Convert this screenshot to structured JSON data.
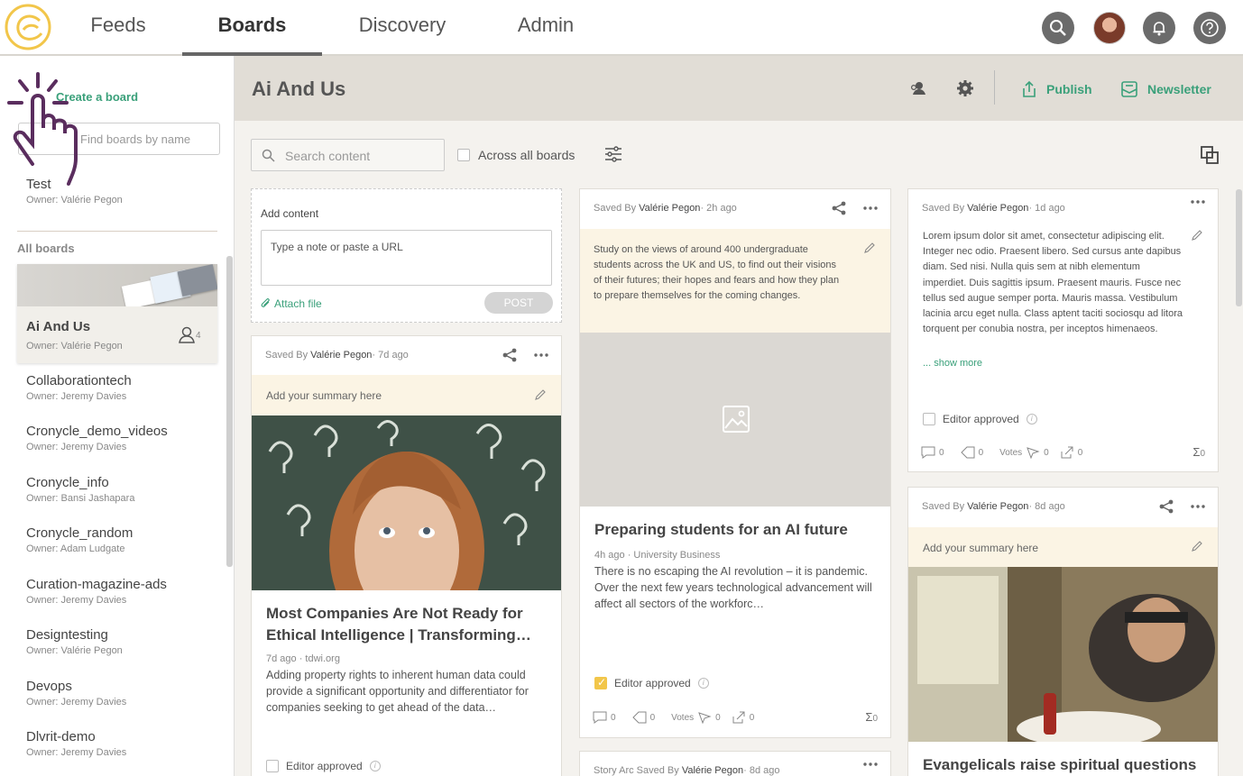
{
  "nav": {
    "tabs": [
      "Feeds",
      "Boards",
      "Discovery",
      "Admin"
    ],
    "active_tab": "Boards"
  },
  "sidebar": {
    "create_label": "Create a board",
    "search_placeholder": "Find boards by name",
    "test_board": {
      "name": "Test",
      "owner": "Owner: Valérie Pegon"
    },
    "all_boards_label": "All boards",
    "active_board": {
      "name": "Ai And Us",
      "owner": "Owner: Valérie Pegon",
      "members": "4"
    },
    "boards": [
      {
        "name": "Collaborationtech",
        "owner": "Owner: Jeremy Davies"
      },
      {
        "name": "Cronycle_demo_videos",
        "owner": "Owner: Jeremy Davies"
      },
      {
        "name": "Cronycle_info",
        "owner": "Owner: Bansi Jashapara"
      },
      {
        "name": "Cronycle_random",
        "owner": "Owner: Adam Ludgate"
      },
      {
        "name": "Curation-magazine-ads",
        "owner": "Owner: Jeremy Davies"
      },
      {
        "name": "Designtesting",
        "owner": "Owner: Valérie Pegon"
      },
      {
        "name": "Devops",
        "owner": "Owner: Jeremy Davies"
      },
      {
        "name": "Dlvrit-demo",
        "owner": "Owner: Jeremy Davies"
      }
    ]
  },
  "board": {
    "title": "Ai And Us",
    "publish_label": "Publish",
    "newsletter_label": "Newsletter"
  },
  "toolbar": {
    "search_placeholder": "Search content",
    "across_label": "Across all boards"
  },
  "add_content": {
    "label": "Add content",
    "placeholder": "Type a note or paste a URL",
    "attach_label": "Attach file",
    "post_label": "POST"
  },
  "cards": {
    "c1": {
      "saved_prefix": "Saved By ",
      "author": "Valérie Pegon",
      "age": "· 7d ago",
      "summary": "Add your summary here",
      "title": "Most Companies Are Not Ready for Ethical Intelligence | Transforming…",
      "source": "7d ago · tdwi.org",
      "desc": "Adding property rights to inherent human data could provide a significant opportunity and differentiator for companies seeking to get ahead of the data…",
      "approved_label": "Editor approved"
    },
    "c2": {
      "saved_prefix": "Saved By ",
      "author": "Valérie Pegon",
      "age": "· 2h ago",
      "summary": "Study on the views of around 400 undergraduate students across the UK and US, to find out their visions of their futures; their hopes and fears and how they plan to prepare themselves for the coming changes.",
      "title": "Preparing students for an AI future",
      "source": "4h ago · University Business",
      "desc": "There is no escaping the AI revolution – it is pandemic. Over the next few years technological advancement will affect all sectors of the workforc…",
      "approved_label": "Editor approved",
      "comments": "0",
      "tags": "0",
      "votes_label": "Votes",
      "votes": "0",
      "shares": "0",
      "total": "0"
    },
    "c3": {
      "saved_prefix": "Saved By ",
      "author": "Valérie Pegon",
      "age": "· 1d ago",
      "text": "Lorem ipsum dolor sit amet, consectetur adipiscing elit. Integer nec odio. Praesent libero. Sed cursus ante dapibus diam. Sed nisi. Nulla quis sem at nibh elementum imperdiet. Duis sagittis ipsum. Praesent mauris. Fusce nec tellus sed augue semper porta. Mauris massa. Vestibulum lacinia arcu eget nulla. Class aptent taciti sociosqu ad litora torquent per conubia nostra, per inceptos himenaeos.",
      "show_more": "... show more",
      "approved_label": "Editor approved",
      "comments": "0",
      "tags": "0",
      "votes_label": "Votes",
      "votes": "0",
      "shares": "0",
      "total": "0"
    },
    "c4": {
      "saved_prefix": "Saved By ",
      "author": "Valérie Pegon",
      "age": "· 8d ago",
      "summary": "Add your summary here",
      "title": "Evangelicals raise spiritual questions"
    },
    "c5": {
      "saved_prefix": "Story Arc Saved By ",
      "author": "Valérie Pegon",
      "age": "· 8d ago"
    }
  },
  "colors": {
    "accent": "#3aa07a",
    "logo": "#f2c64a",
    "highlight": "#fbf4e4"
  }
}
